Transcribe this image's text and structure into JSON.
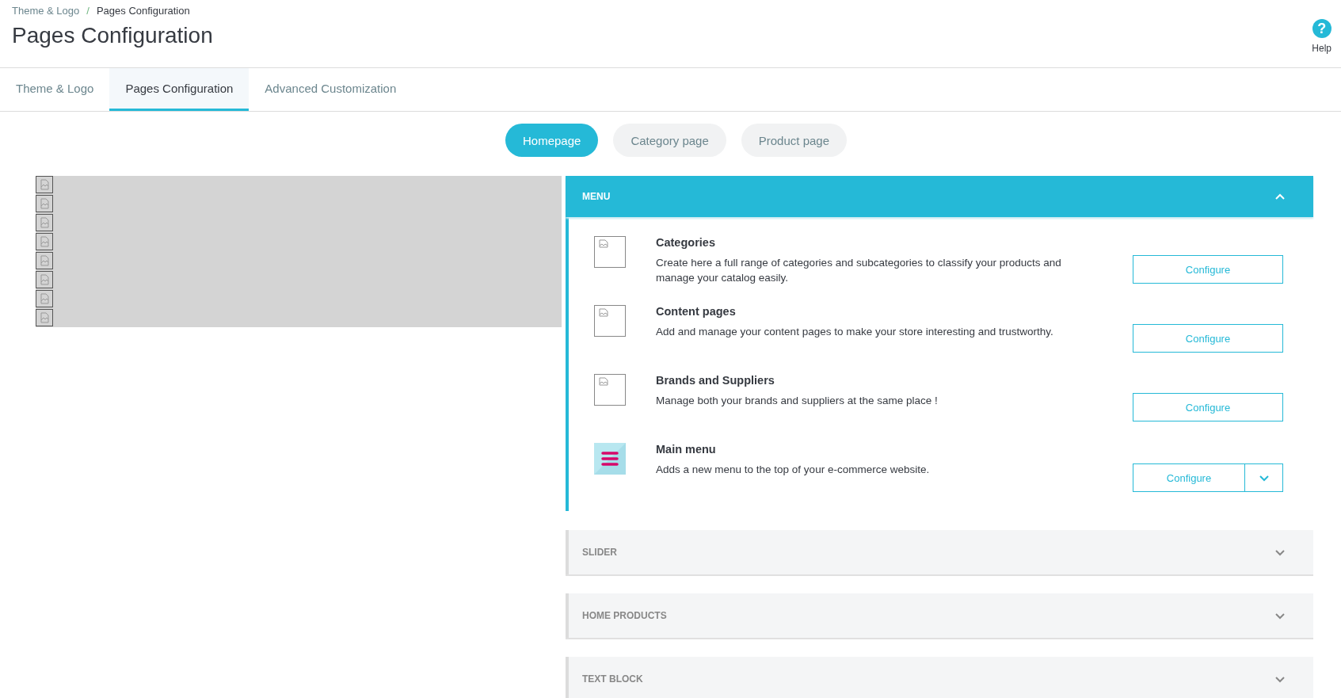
{
  "breadcrumb": [
    {
      "label": "Theme & Logo",
      "current": false
    },
    {
      "label": "Pages Configuration",
      "current": true
    }
  ],
  "breadcrumb_separator": "/",
  "title": "Pages Configuration",
  "help": {
    "glyph": "?",
    "label": "Help"
  },
  "tabs": [
    {
      "label": "Theme & Logo",
      "selected": false
    },
    {
      "label": "Pages Configuration",
      "selected": true
    },
    {
      "label": "Advanced Customization",
      "selected": false
    }
  ],
  "page_types": [
    {
      "label": "Homepage",
      "selected": true
    },
    {
      "label": "Category page",
      "selected": false
    },
    {
      "label": "Product page",
      "selected": false
    }
  ],
  "sections": [
    {
      "title": "MENU",
      "expanded": true,
      "items": [
        {
          "kind": "broken",
          "name": "Categories",
          "description": "Create here a full range of categories and subcategories to classify your products and manage your catalog easily.",
          "button": "Configure",
          "split": false
        },
        {
          "kind": "broken",
          "name": "Content pages",
          "description": "Add and manage your content pages to make your store interesting and trustworthy.",
          "button": "Configure",
          "split": false
        },
        {
          "kind": "broken",
          "name": "Brands and Suppliers",
          "description": "Manage both your brands and suppliers at the same place !",
          "button": "Configure",
          "split": false
        },
        {
          "kind": "menu",
          "name": "Main menu",
          "description": "Adds a new menu to the top of your e-commerce website.",
          "button": "Configure",
          "split": true
        }
      ]
    },
    {
      "title": "SLIDER",
      "expanded": false
    },
    {
      "title": "HOME PRODUCTS",
      "expanded": false
    },
    {
      "title": "TEXT BLOCK",
      "expanded": false
    }
  ]
}
